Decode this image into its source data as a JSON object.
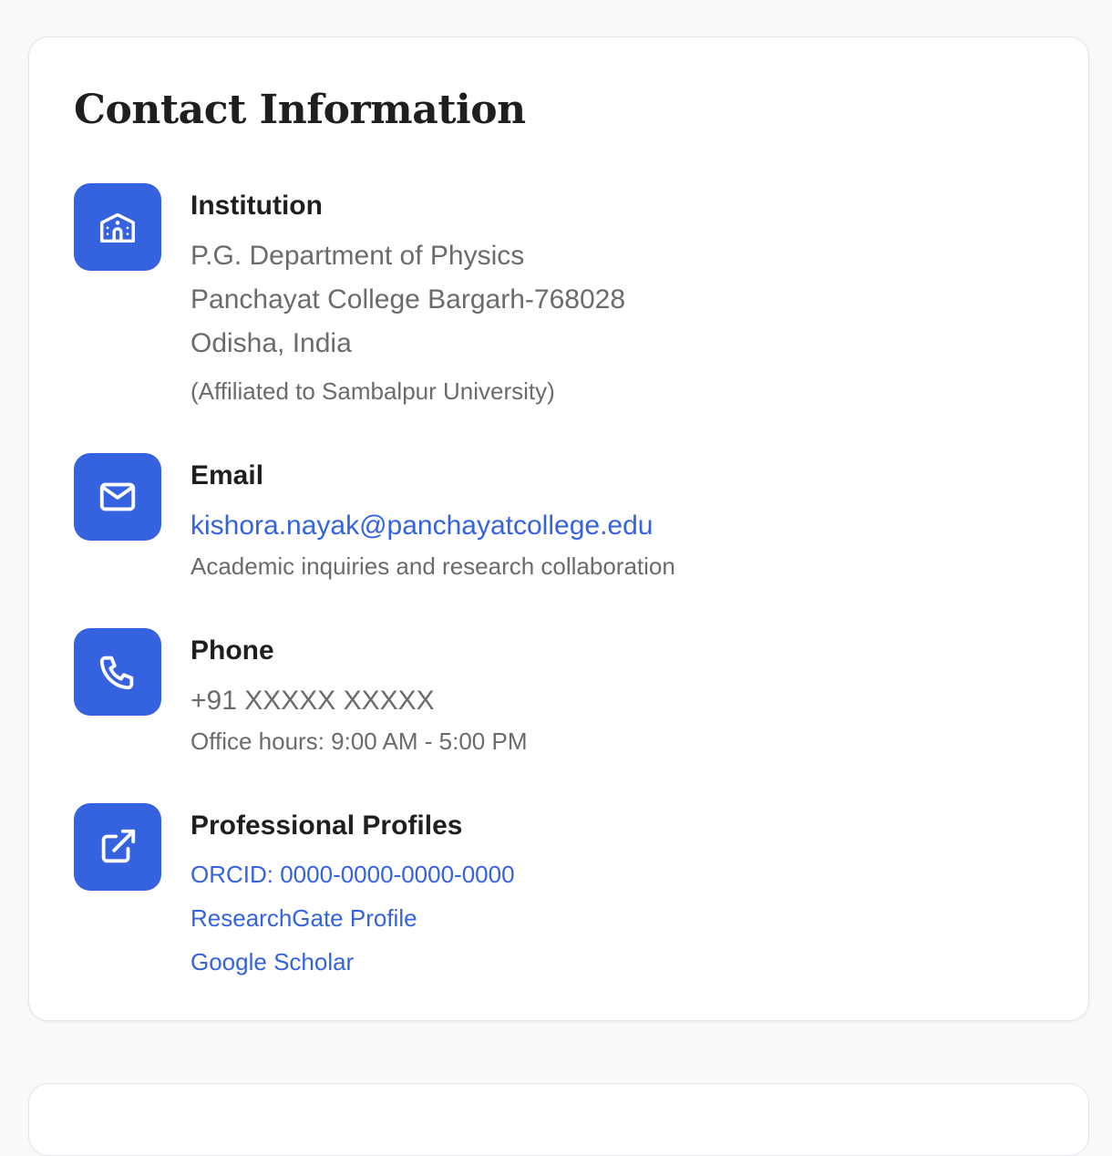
{
  "section": {
    "title": "Contact Information"
  },
  "institution": {
    "label": "Institution",
    "icon": "building-icon",
    "lines": [
      "P.G. Department of Physics",
      "Panchayat College Bargarh-768028",
      "Odisha, India"
    ],
    "note": "(Affiliated to Sambalpur University)"
  },
  "email": {
    "label": "Email",
    "icon": "mail-icon",
    "address": "kishora.nayak@panchayatcollege.edu",
    "note": "Academic inquiries and research collaboration"
  },
  "phone": {
    "label": "Phone",
    "icon": "phone-icon",
    "number": "+91 XXXXX XXXXX",
    "note": "Office hours: 9:00 AM - 5:00 PM"
  },
  "profiles": {
    "label": "Professional Profiles",
    "icon": "external-link-icon",
    "links": [
      "ORCID: 0000-0000-0000-0000",
      "ResearchGate Profile",
      "Google Scholar"
    ]
  },
  "colors": {
    "accent": "#3563e0",
    "heading": "#1f1f1f",
    "muted": "#6b6b6b",
    "background": "#f8f9fb",
    "card": "#ffffff"
  }
}
